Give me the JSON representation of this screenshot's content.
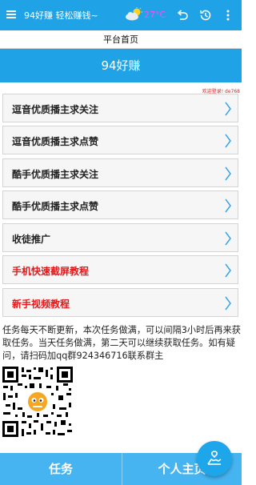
{
  "appbar": {
    "title": "94好赚 轻松赚钱~",
    "temperature": "27°C"
  },
  "subheader": {
    "title": "平台首页"
  },
  "banner": {
    "title": "94好赚"
  },
  "welcome": "欢迎登录! de768",
  "menu": [
    {
      "label": "逗音优质播主求关注",
      "color": "#222222"
    },
    {
      "label": "逗音优质播主求点赞",
      "color": "#222222"
    },
    {
      "label": "酷手优质播主求关注",
      "color": "#222222"
    },
    {
      "label": "酷手优质播主求点赞",
      "color": "#222222"
    },
    {
      "label": "收徒推广",
      "color": "#222222"
    },
    {
      "label": "手机快速截屏教程",
      "color": "#e3191b"
    },
    {
      "label": "新手视频教程",
      "color": "#e3191b"
    }
  ],
  "info": "任务每天不断更新，本次任务做满，可以间隔3小时后再来获取任务。当天任务做满，第二天可以继续获取任务。如有疑问，请扫码加qq群924346716联系群主",
  "bottom_tabs": {
    "task": "任务",
    "profile": "个人主页"
  },
  "colors": {
    "primary": "#1fa2e6",
    "bottom_bar": "#45b4f0",
    "accent_red": "#e3191b",
    "temperature": "#ff4ef0"
  }
}
